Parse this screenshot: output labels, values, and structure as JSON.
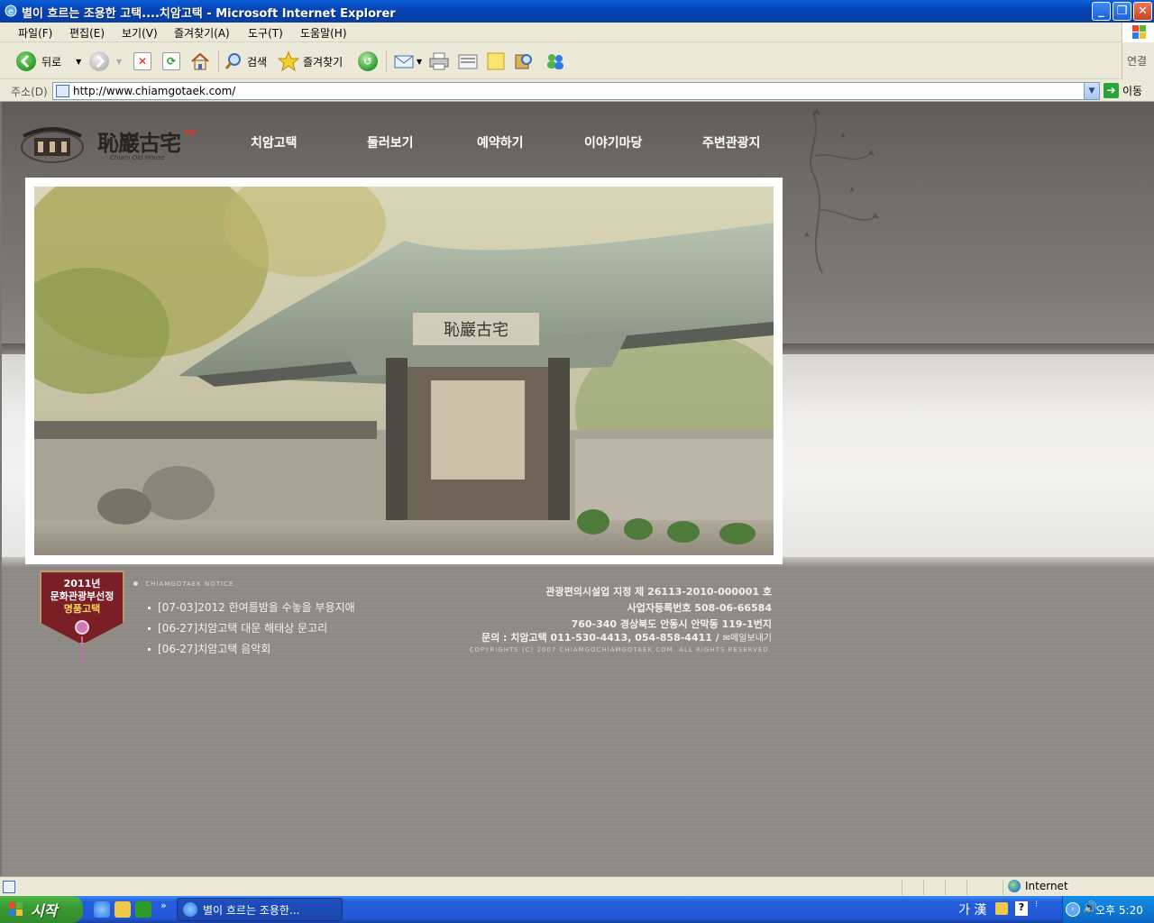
{
  "window": {
    "title": "별이 흐르는 조용한 고택....치암고택 - Microsoft Internet Explorer"
  },
  "menu": {
    "items": [
      "파일(F)",
      "편집(E)",
      "보기(V)",
      "즐겨찾기(A)",
      "도구(T)",
      "도움말(H)"
    ]
  },
  "toolbar": {
    "back_label": "뒤로",
    "search_label": "검색",
    "favorites_label": "즐겨찾기",
    "links_label": "연결"
  },
  "address": {
    "label": "주소(D)",
    "url": "http://www.chiamgotaek.com/",
    "go_label": "이동"
  },
  "site": {
    "logo_hanja": "恥巖古宅",
    "logo_sub": "Chiam Old House",
    "logo_tm": "TM",
    "nav": [
      "치암고택",
      "둘러보기",
      "예약하기",
      "이야기마당",
      "주변관광지"
    ],
    "hero_signboard": "恥巖古宅",
    "badge": {
      "year": "2011년",
      "line1": "문화관광부선정",
      "line2": "명품고택"
    },
    "notice_title": "CHIAMGOTAEK NOTICE",
    "notices": [
      "[07-03]2012 한여름밤을 수놓을 부용지애",
      "[06-27]치암고택 대문 해태상 문고리",
      "[06-27]치암고택 음악회"
    ],
    "info": {
      "license": "관광편의시설업 지정 제 26113-2010-000001 호",
      "business_no": "사업자등록번호 508-06-66584",
      "address": "760-340 경상북도 안동시 안막동 119-1번지",
      "contact": "문의 : 치암고택 011-530-4413, 054-858-4411 /",
      "mail_label": "메일보내기",
      "copyright": "COPYRIGHTS (C) 2007 CHIAMGOCHIAMGOTAEK.COM. ALL RIGHTS RESERVED."
    }
  },
  "status": {
    "zone": "Internet"
  },
  "taskbar": {
    "start_label": "시작",
    "task_label": "별이 흐르는 조용한...",
    "ime": "가 漢",
    "clock": "오후 5:20"
  }
}
